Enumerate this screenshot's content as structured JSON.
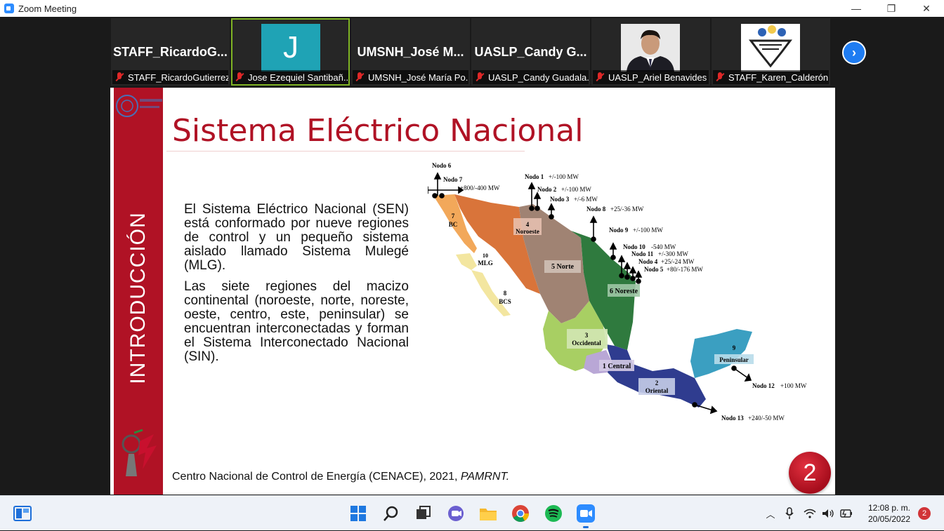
{
  "window": {
    "title": "Zoom Meeting",
    "controls": {
      "minimize": "—",
      "restore": "❐",
      "close": "✕"
    }
  },
  "participants": [
    {
      "big_name": "STAFF_RicardoG...",
      "label": "STAFF_RicardoGutierrez",
      "muted": true,
      "video": "name"
    },
    {
      "big_name": "",
      "initial": "J",
      "label": "Jose Ezequiel Santibañ...",
      "muted": true,
      "video": "avatar",
      "active": true
    },
    {
      "big_name": "UMSNH_José  M...",
      "label": "UMSNH_José María Po...",
      "muted": true,
      "video": "name"
    },
    {
      "big_name": "UASLP_Candy  G...",
      "label": "UASLP_Candy Guadala...",
      "muted": true,
      "video": "name"
    },
    {
      "big_name": "",
      "label": "UASLP_Ariel Benavides",
      "muted": true,
      "video": "photo"
    },
    {
      "big_name": "",
      "label": "STAFF_Karen_Calderón",
      "muted": true,
      "video": "logo"
    }
  ],
  "slide": {
    "side_label": "INTRODUCCIÓN",
    "title": "Sistema Eléctrico Nacional",
    "paragraph1": "El Sistema Eléctrico Nacional (SEN) está conformado por nueve regiones de control y un pequeño sistema aislado llamado Sistema Mulegé (MLG).",
    "paragraph2": "Las siete regiones del macizo continental (noroeste, norte, noreste, oeste, centro, este, peninsular) se encuentran interconectadas y forman el Sistema Interconectado Nacional (SIN).",
    "source_main": "Centro Nacional de Control de Energía (CENACE), 2021, ",
    "source_italic": "PAMRNT.",
    "page_number": "2",
    "map": {
      "regions": [
        {
          "num": "1",
          "name": "Central",
          "color": "#b9a7d6"
        },
        {
          "num": "2",
          "name": "Oriental",
          "color": "#2f3c8f"
        },
        {
          "num": "3",
          "name": "Occidental",
          "color": "#a8cf63"
        },
        {
          "num": "4",
          "name": "Noroeste",
          "color": "#d9743a"
        },
        {
          "num": "5",
          "name": "Norte",
          "color": "#a08373"
        },
        {
          "num": "6",
          "name": "Noreste",
          "color": "#2f7a3e"
        },
        {
          "num": "7",
          "name": "BC",
          "color": "#f2a85a"
        },
        {
          "num": "8",
          "name": "BCS",
          "color": "#f3e6a0"
        },
        {
          "num": "9",
          "name": "Peninsular",
          "color": "#3b9fc1"
        },
        {
          "num": "10",
          "name": "MLG",
          "color": "#f3e6a0"
        }
      ],
      "nodes": [
        {
          "name": "Nodo 6",
          "value": ""
        },
        {
          "name": "Nodo 7",
          "value": "+800/-400 MW"
        },
        {
          "name": "Nodo 1",
          "value": "+/-100 MW"
        },
        {
          "name": "Nodo 2",
          "value": "+/-100 MW"
        },
        {
          "name": "Nodo 3",
          "value": "+/-6 MW"
        },
        {
          "name": "Nodo 8",
          "value": "+25/-36 MW"
        },
        {
          "name": "Nodo 9",
          "value": "+/-100 MW"
        },
        {
          "name": "Nodo 10",
          "value": "-540 MW"
        },
        {
          "name": "Nodo 11",
          "value": "+/-300 MW"
        },
        {
          "name": "Nodo 4",
          "value": "+25/-24 MW"
        },
        {
          "name": "Nodo 5",
          "value": "+80/-176 MW"
        },
        {
          "name": "Nodo 12",
          "value": "+100 MW"
        },
        {
          "name": "Nodo 13",
          "value": "+240/-50 MW"
        }
      ]
    }
  },
  "taskbar": {
    "time": "12:08 p. m.",
    "date": "20/05/2022",
    "notifications": "2",
    "apps": [
      "widgets",
      "start",
      "search",
      "task-view",
      "teams-chat",
      "file-explorer",
      "chrome",
      "spotify",
      "zoom"
    ]
  }
}
